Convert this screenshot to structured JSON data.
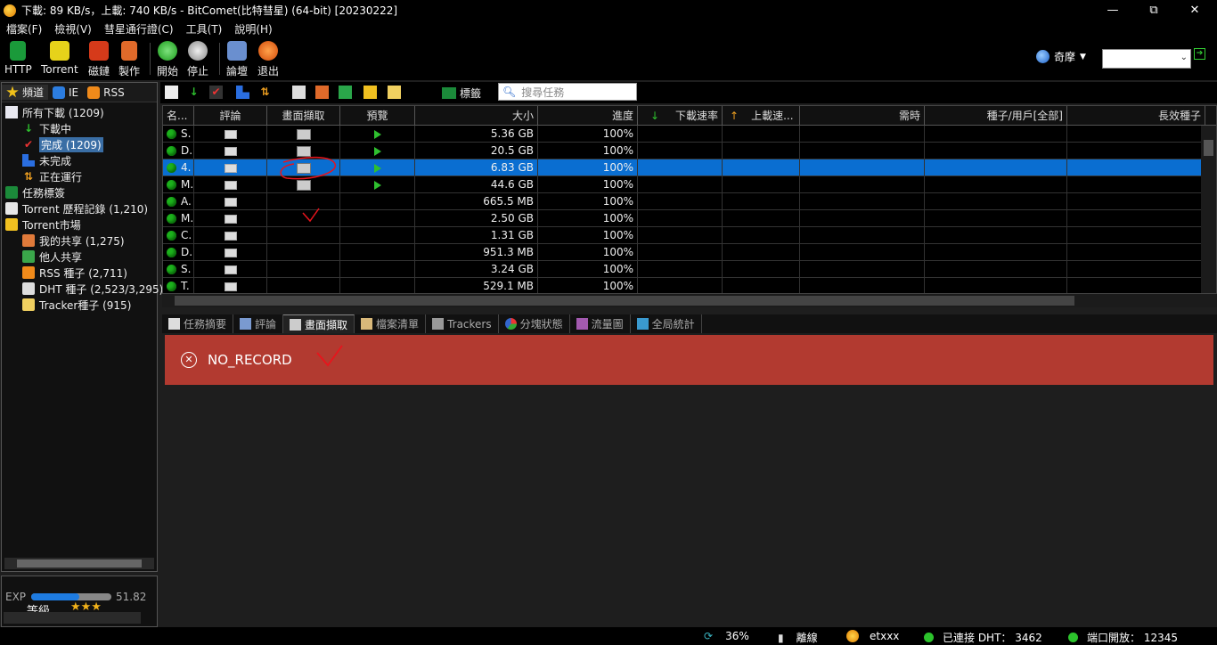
{
  "window": {
    "title": "下載: 89 KB/s，上載: 740 KB/s - BitComet(比特彗星) (64-bit) [20230222]",
    "min": "—",
    "max": "⧉",
    "close": "✕"
  },
  "menu": [
    "檔案(F)",
    "檢視(V)",
    "彗星通行證(C)",
    "工具(T)",
    "說明(H)"
  ],
  "toolbar": {
    "http": "HTTP",
    "torrent": "Torrent",
    "magnet": "磁鏈",
    "make": "製作",
    "start": "開始",
    "stop": "停止",
    "forum": "論壇",
    "exit": "退出"
  },
  "lang": {
    "label": "奇摩",
    "arrow": "▼"
  },
  "sidebar": {
    "tabs": [
      "頻道",
      "IE",
      "RSS"
    ],
    "tree": {
      "all": "所有下載 (1209)",
      "downloading": "下載中",
      "completed": "完成 (1209)",
      "incomplete": "未完成",
      "running": "正在運行",
      "tags": "任務標簽",
      "history": "Torrent 歷程記錄 (1,210)",
      "market": "Torrent市場",
      "myshare": "我的共享 (1,275)",
      "othershare": "他人共享",
      "rss": "RSS 種子 (2,711)",
      "dht": "DHT 種子 (2,523/3,295)",
      "tracker": "Tracker種子 (915)"
    }
  },
  "exp": {
    "label": "EXP",
    "value": "51.82",
    "level": "等級",
    "stars": "★★★",
    "progress": 0.6
  },
  "taskbar": {
    "tags": "標籤",
    "search_placeholder": "搜尋任務"
  },
  "grid": {
    "headers": [
      "名...",
      "評論",
      "畫面擷取",
      "預覽",
      "大小",
      "進度",
      "下載速率",
      "上載速...",
      "需時",
      "種子/用戶[全部]",
      "長效種子"
    ],
    "rows": [
      {
        "name": "S.",
        "size": "5.36 GB",
        "progress": "100%",
        "img": true,
        "play": true
      },
      {
        "name": "D.",
        "size": "20.5 GB",
        "progress": "100%",
        "img": true,
        "play": true
      },
      {
        "name": "4.",
        "size": "6.83 GB",
        "progress": "100%",
        "img": true,
        "play": true,
        "selected": true
      },
      {
        "name": "M.",
        "size": "44.6 GB",
        "progress": "100%",
        "img": true,
        "play": true
      },
      {
        "name": "A.",
        "size": "665.5 MB",
        "progress": "100%",
        "img": false,
        "play": false
      },
      {
        "name": "M.",
        "size": "2.50 GB",
        "progress": "100%",
        "img": false,
        "play": false
      },
      {
        "name": "C.",
        "size": "1.31 GB",
        "progress": "100%",
        "img": false,
        "play": false
      },
      {
        "name": "D.",
        "size": "951.3 MB",
        "progress": "100%",
        "img": false,
        "play": false
      },
      {
        "name": "S.",
        "size": "3.24 GB",
        "progress": "100%",
        "img": false,
        "play": false
      },
      {
        "name": "T.",
        "size": "529.1 MB",
        "progress": "100%",
        "img": false,
        "play": false
      }
    ]
  },
  "bottom_tabs": [
    "任務摘要",
    "評論",
    "畫面擷取",
    "檔案清單",
    "Trackers",
    "分塊狀態",
    "流量圖",
    "全局統計"
  ],
  "error": {
    "text": "NO_RECORD"
  },
  "statusbar": {
    "pct": "36%",
    "offline": "離線",
    "user": "etxxx",
    "dht": "已連接 DHT： 3462",
    "port": "端口開放： 12345"
  },
  "colors": {
    "selected_row": "#0a6ed1",
    "error_bg": "#b23a30",
    "annotation": "#e8141c"
  }
}
